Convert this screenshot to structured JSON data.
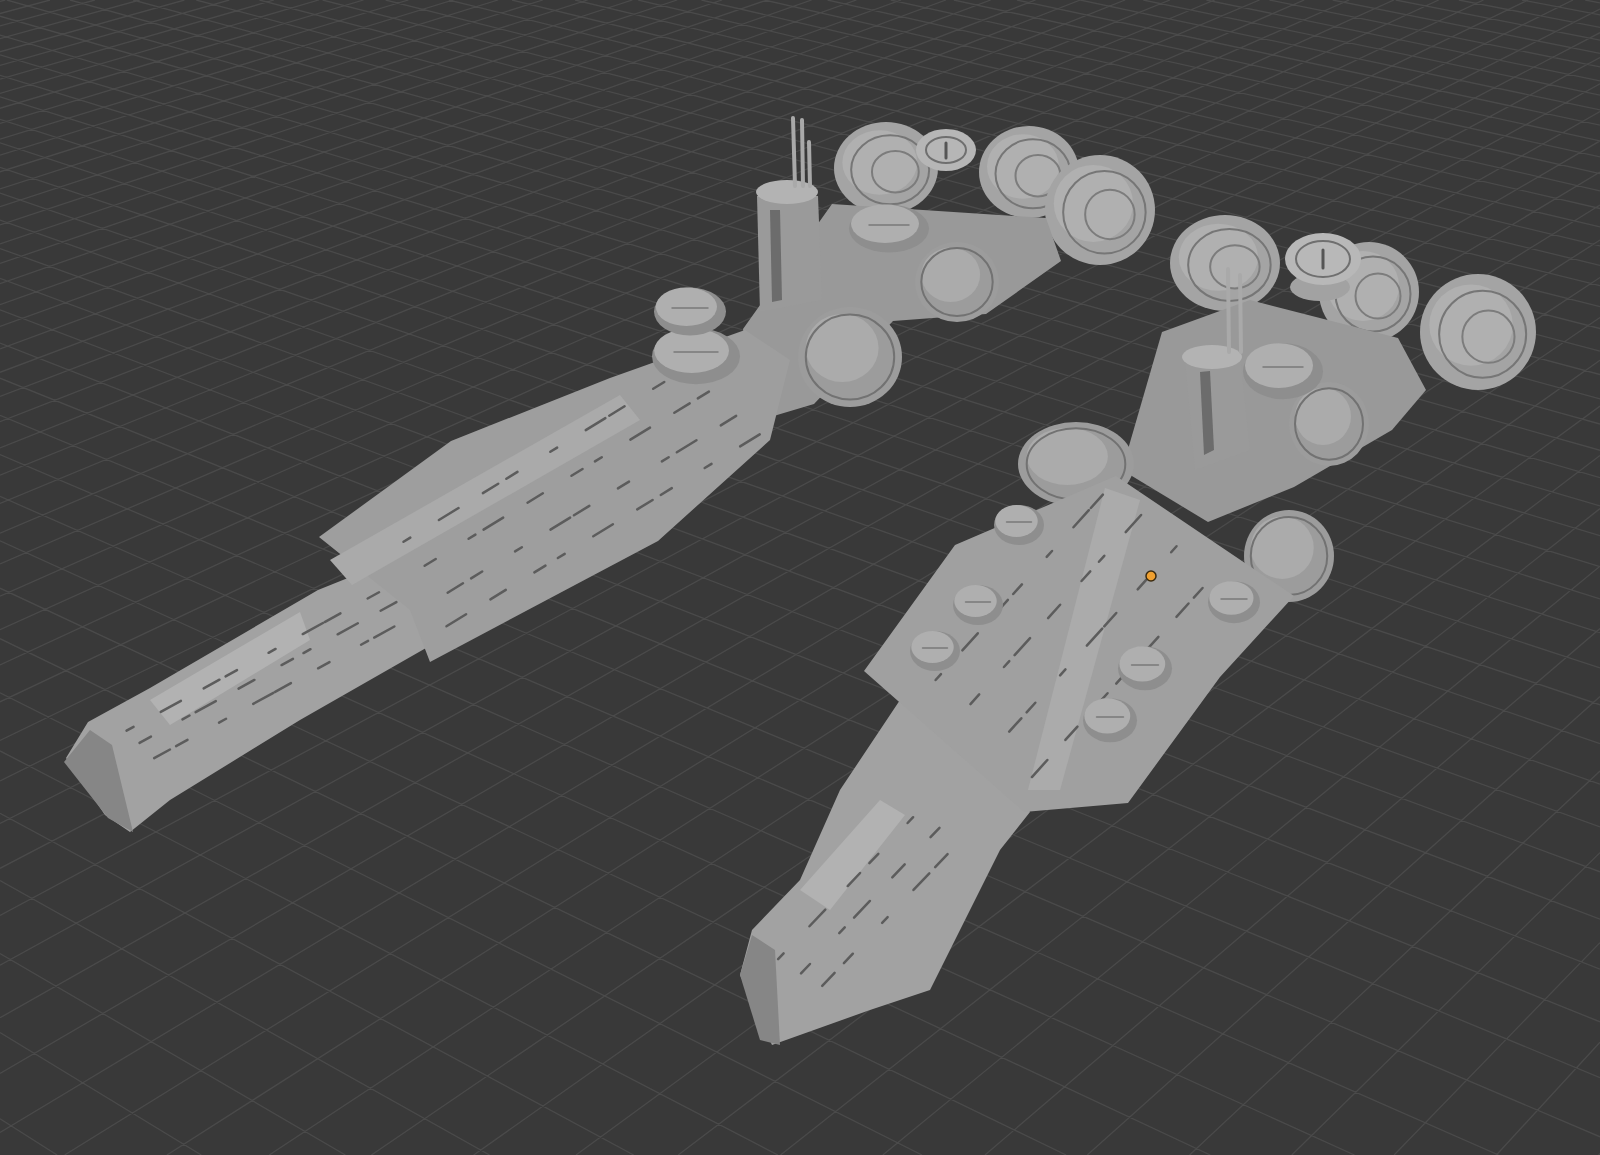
{
  "viewport": {
    "models": [
      {
        "selected": false
      },
      {
        "selected": true
      }
    ]
  }
}
